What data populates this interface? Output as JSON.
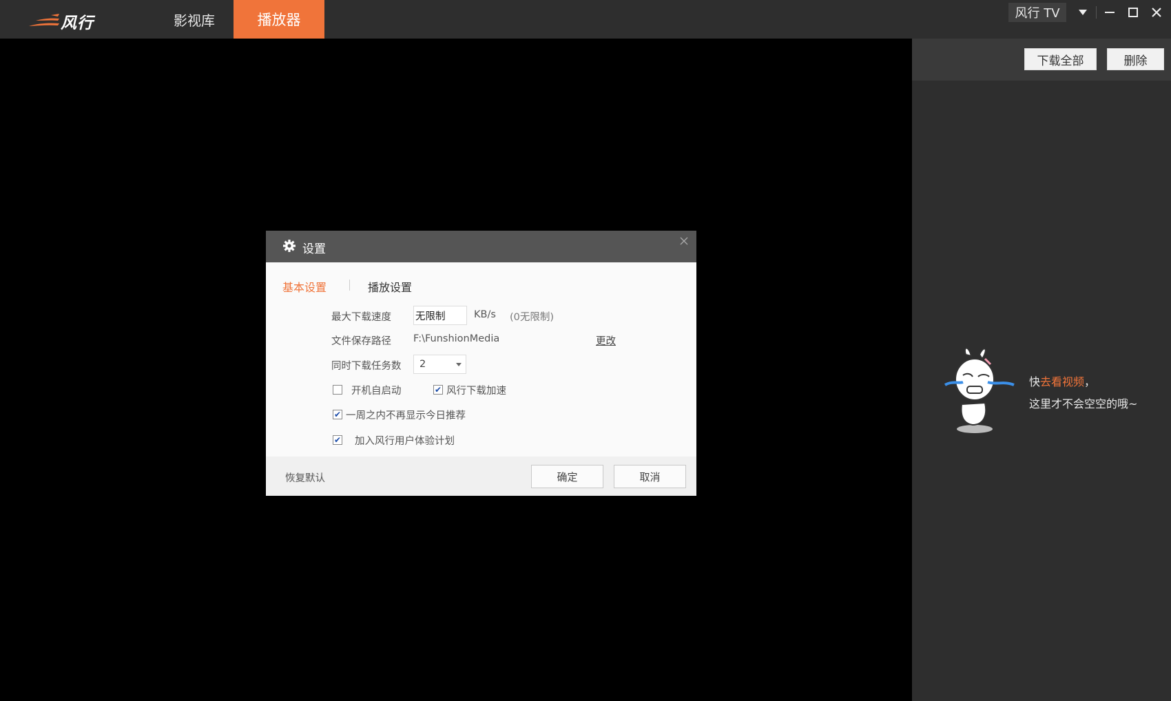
{
  "header": {
    "logo_text": "风行",
    "tabs": [
      {
        "label": "影视库",
        "active": false
      },
      {
        "label": "播放器",
        "active": true
      }
    ],
    "account_label": "风行 TV",
    "accent_color": "#f0743a"
  },
  "right_panel": {
    "download_all_label": "下载全部",
    "delete_label": "删除",
    "empty_prefix": "快",
    "empty_link": "去看视频",
    "empty_suffix": "，",
    "empty_line2": "这里才不会空空的哦~"
  },
  "dialog": {
    "title": "设置",
    "tabs": [
      {
        "label": "基本设置",
        "active": true
      },
      {
        "label": "播放设置",
        "active": false
      }
    ],
    "max_speed_label": "最大下载速度",
    "max_speed_value": "无限制",
    "speed_unit": "KB/s",
    "speed_hint": "(0无限制)",
    "save_path_label": "文件保存路径",
    "save_path_value": "F:\\FunshionMedia",
    "change_label": "更改",
    "concurrent_label": "同时下载任务数",
    "concurrent_value": "2",
    "options": [
      {
        "label": "开机自启动",
        "checked": false
      },
      {
        "label": "风行下载加速",
        "checked": true
      },
      {
        "label": "一周之内不再显示今日推荐",
        "checked": true
      },
      {
        "label": "加入风行用户体验计划",
        "checked": true
      }
    ],
    "restore_label": "恢复默认",
    "ok_label": "确定",
    "cancel_label": "取消"
  }
}
